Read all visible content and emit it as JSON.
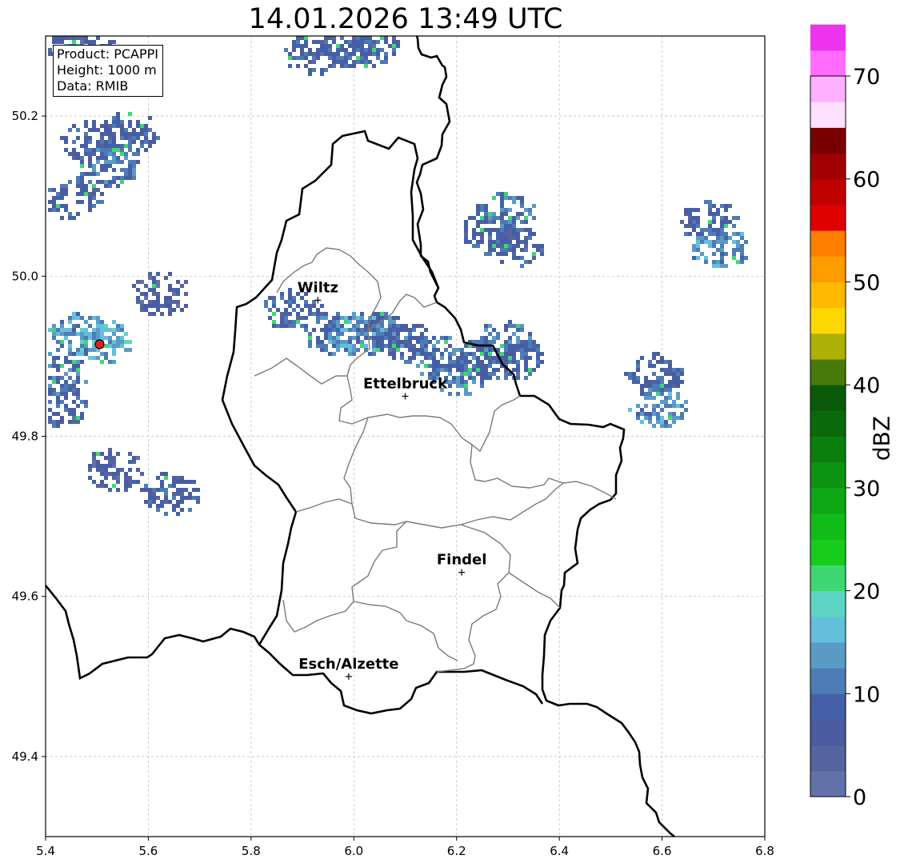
{
  "title": "14.01.2026 13:49 UTC",
  "info_box": {
    "product": "Product: PCAPPI",
    "height": "Height: 1000 m",
    "data": "Data: RMIB"
  },
  "axes": {
    "lon_min": 5.4,
    "lon_max": 6.8,
    "lat_min": 49.3,
    "lat_max": 50.3,
    "x_ticks": [
      "5.4",
      "5.6",
      "5.8",
      "6.0",
      "6.2",
      "6.4",
      "6.6",
      "6.8"
    ],
    "y_ticks": [
      "49.4",
      "49.6",
      "49.8",
      "50.0",
      "50.2"
    ],
    "grid": true
  },
  "cities": [
    {
      "name": "Wiltz",
      "lon": 5.93,
      "lat": 49.97
    },
    {
      "name": "Ettelbruck",
      "lon": 6.1,
      "lat": 49.85
    },
    {
      "name": "Findel",
      "lon": 6.21,
      "lat": 49.63
    },
    {
      "name": "Esch/Alzette",
      "lon": 5.99,
      "lat": 49.5
    }
  ],
  "radar_site": {
    "lon": 5.505,
    "lat": 49.915,
    "color": "#e02020"
  },
  "colorbar": {
    "label": "dBZ",
    "min": 0,
    "max": 70,
    "step": 2.5,
    "ticks": [
      "0",
      "10",
      "20",
      "30",
      "40",
      "50",
      "60",
      "70"
    ],
    "colors": [
      "#6271a8",
      "#55649f",
      "#4a5ba0",
      "#4460a8",
      "#4d7bb5",
      "#5a9bc6",
      "#64bfdb",
      "#5ed5c4",
      "#3fd773",
      "#17cc1d",
      "#10bd18",
      "#0ea815",
      "#0d9412",
      "#0b7f0e",
      "#0a6a0b",
      "#085a09",
      "#477a09",
      "#adb107",
      "#ffd700",
      "#ffba00",
      "#ff9c00",
      "#ff7e00",
      "#e00000",
      "#c10000",
      "#a10000",
      "#7a0000",
      "#ffe0ff",
      "#ffb2ff",
      "#ff6cff",
      "#ee33ee"
    ]
  },
  "echoes": [
    {
      "lon": 5.44,
      "lat": 50.29,
      "intensity": 2.0
    },
    {
      "lon": 5.48,
      "lat": 50.28,
      "intensity": 2.0
    },
    {
      "lon": 5.92,
      "lat": 50.28,
      "intensity": 3.0
    },
    {
      "lon": 5.99,
      "lat": 50.29,
      "intensity": 3.0
    },
    {
      "lon": 6.03,
      "lat": 50.29,
      "intensity": 3.0
    },
    {
      "lon": 5.48,
      "lat": 50.17,
      "intensity": 3.0
    },
    {
      "lon": 5.52,
      "lat": 50.14,
      "intensity": 4.0
    },
    {
      "lon": 5.45,
      "lat": 50.1,
      "intensity": 3.0
    },
    {
      "lon": 5.56,
      "lat": 50.18,
      "intensity": 3.0
    },
    {
      "lon": 5.62,
      "lat": 49.98,
      "intensity": 2.0
    },
    {
      "lon": 5.46,
      "lat": 49.93,
      "intensity": 5.0
    },
    {
      "lon": 5.51,
      "lat": 49.92,
      "intensity": 6.0
    },
    {
      "lon": 5.42,
      "lat": 49.88,
      "intensity": 4.0
    },
    {
      "lon": 5.42,
      "lat": 49.84,
      "intensity": 3.0
    },
    {
      "lon": 5.88,
      "lat": 49.96,
      "intensity": 3.0
    },
    {
      "lon": 5.96,
      "lat": 49.93,
      "intensity": 4.0
    },
    {
      "lon": 6.0,
      "lat": 49.93,
      "intensity": 5.0
    },
    {
      "lon": 6.05,
      "lat": 49.93,
      "intensity": 4.0
    },
    {
      "lon": 6.1,
      "lat": 49.92,
      "intensity": 3.0
    },
    {
      "lon": 6.16,
      "lat": 49.9,
      "intensity": 4.0
    },
    {
      "lon": 6.2,
      "lat": 49.88,
      "intensity": 4.0
    },
    {
      "lon": 6.25,
      "lat": 49.9,
      "intensity": 3.0
    },
    {
      "lon": 6.29,
      "lat": 49.92,
      "intensity": 4.0
    },
    {
      "lon": 6.31,
      "lat": 49.9,
      "intensity": 3.0
    },
    {
      "lon": 6.26,
      "lat": 50.06,
      "intensity": 3.0
    },
    {
      "lon": 6.29,
      "lat": 50.08,
      "intensity": 4.0
    },
    {
      "lon": 6.31,
      "lat": 50.04,
      "intensity": 3.0
    },
    {
      "lon": 6.58,
      "lat": 49.88,
      "intensity": 3.0
    },
    {
      "lon": 6.59,
      "lat": 49.84,
      "intensity": 5.0
    },
    {
      "lon": 6.69,
      "lat": 50.07,
      "intensity": 3.0
    },
    {
      "lon": 6.71,
      "lat": 50.04,
      "intensity": 5.0
    },
    {
      "lon": 5.64,
      "lat": 49.73,
      "intensity": 3.0
    },
    {
      "lon": 5.53,
      "lat": 49.76,
      "intensity": 2.0
    }
  ]
}
